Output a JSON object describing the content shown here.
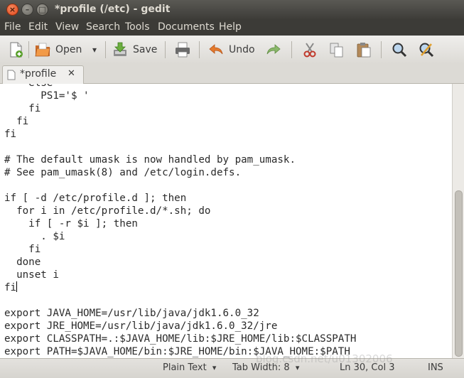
{
  "window": {
    "title": "*profile (/etc) - gedit",
    "close_glyph": "×",
    "min_glyph": "–",
    "max_glyph": "□"
  },
  "menu": [
    "File",
    "Edit",
    "View",
    "Search",
    "Tools",
    "Documents",
    "Help"
  ],
  "toolbar": {
    "new_icon": "new-document-icon",
    "open_label": "Open",
    "save_label": "Save",
    "print_icon": "print-icon",
    "undo_label": "Undo",
    "redo_icon": "redo-icon",
    "cut_icon": "cut-icon",
    "copy_icon": "copy-icon",
    "paste_icon": "paste-icon",
    "find_icon": "find-icon",
    "replace_icon": "find-replace-icon",
    "dropdown_glyph": "▾"
  },
  "tab": {
    "label": "*profile",
    "close_glyph": "✕"
  },
  "editor": {
    "lines": [
      "    else",
      "      PS1='$ '",
      "    fi",
      "  fi",
      "fi",
      "",
      "# The default umask is now handled by pam_umask.",
      "# See pam_umask(8) and /etc/login.defs.",
      "",
      "if [ -d /etc/profile.d ]; then",
      "  for i in /etc/profile.d/*.sh; do",
      "    if [ -r $i ]; then",
      "      . $i",
      "    fi",
      "  done",
      "  unset i",
      "fi",
      "",
      "export JAVA_HOME=/usr/lib/java/jdk1.6.0_32",
      "export JRE_HOME=/usr/lib/java/jdk1.6.0_32/jre",
      "export CLASSPATH=.:$JAVA_HOME/lib:$JRE_HOME/lib:$CLASSPATH",
      "export PATH=$JAVA_HOME/bin:$JRE_HOME/bin:$JAVA_HOME:$PATH"
    ],
    "cursor_line": 16
  },
  "status": {
    "language": "Plain Text",
    "tab_width": "Tab Width: 8",
    "position": "Ln 30, Col 3",
    "mode": "INS",
    "dropdown_glyph": "▾"
  },
  "watermark": "blog.csdn.net/u01302006"
}
